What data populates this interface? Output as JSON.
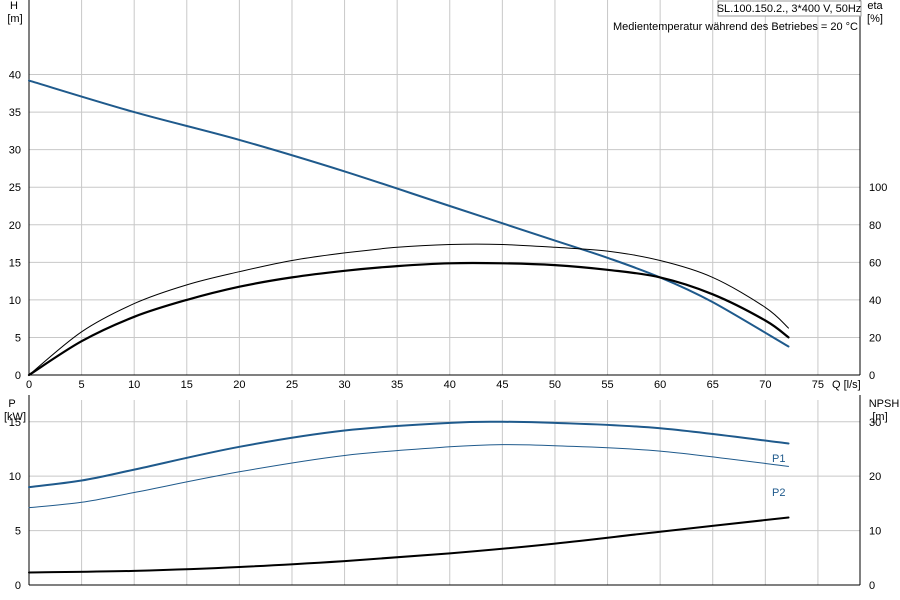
{
  "chart_data": [
    {
      "type": "line",
      "title_box": "SL.100.150.2., 3*400 V, 50Hz",
      "annotation": "Medientemperatur während des Betriebes = 20 °C",
      "xlabel": "Q [l/s]",
      "x_ticks": [
        "0",
        "5",
        "10",
        "15",
        "20",
        "25",
        "30",
        "35",
        "40",
        "45",
        "50",
        "55",
        "60",
        "65",
        "70",
        "75"
      ],
      "xlim": [
        0,
        79
      ],
      "left_axis": {
        "label": "H",
        "unit": "[m]",
        "ylim": [
          0,
          45
        ],
        "ticks": [
          "0",
          "5",
          "10",
          "15",
          "20",
          "25",
          "30",
          "35",
          "40"
        ]
      },
      "right_axis": {
        "label": "eta",
        "unit": "[%]",
        "ylim": [
          0,
          180
        ],
        "ticks": [
          "0",
          "20",
          "40",
          "60",
          "80",
          "100"
        ]
      },
      "grid": true,
      "series": [
        {
          "id": "H",
          "axis": "left",
          "color": "#1f5a8c",
          "width": 2,
          "x": [
            0,
            10,
            20,
            30,
            40,
            50,
            55,
            60,
            65,
            72.2
          ],
          "y": [
            39.2,
            35.0,
            31.3,
            27.1,
            22.5,
            17.9,
            15.6,
            13.0,
            9.7,
            3.8
          ]
        },
        {
          "id": "eta1",
          "axis": "right",
          "color": "#000000",
          "width": 1,
          "x": [
            0,
            5,
            10,
            15,
            20,
            25,
            30,
            35,
            40,
            45,
            50,
            55,
            60,
            65,
            70,
            72.2
          ],
          "y": [
            0,
            23,
            38,
            48,
            55,
            61,
            65,
            68,
            69.5,
            69.5,
            68,
            66,
            61,
            52,
            36,
            25
          ]
        },
        {
          "id": "eta2",
          "axis": "right",
          "color": "#000000",
          "width": 2.2,
          "x": [
            0,
            5,
            10,
            15,
            20,
            25,
            30,
            35,
            40,
            45,
            50,
            55,
            60,
            65,
            70,
            72.2
          ],
          "y": [
            0,
            18,
            31,
            40,
            47,
            52,
            55.5,
            58,
            59.5,
            59.5,
            58.5,
            56,
            52,
            43,
            29,
            20
          ]
        }
      ]
    },
    {
      "type": "line",
      "left_axis": {
        "label": "P",
        "unit": "[kW]",
        "ylim": [
          0,
          17
        ],
        "ticks": [
          "0",
          "5",
          "10",
          "15"
        ]
      },
      "right_axis": {
        "label": "NPSH",
        "unit": "[m]",
        "ylim": [
          0,
          34
        ],
        "ticks": [
          "0",
          "10",
          "20",
          "30"
        ]
      },
      "xlim": [
        0,
        79
      ],
      "grid": true,
      "series": [
        {
          "id": "P1",
          "name": "P1",
          "axis": "left",
          "color": "#1f5a8c",
          "width": 2,
          "x": [
            0,
            5,
            10,
            20,
            30,
            40,
            45,
            50,
            60,
            72.2
          ],
          "y": [
            9.0,
            9.6,
            10.6,
            12.7,
            14.2,
            14.9,
            15.0,
            14.9,
            14.4,
            13.0
          ]
        },
        {
          "id": "P2",
          "name": "P2",
          "axis": "left",
          "color": "#1f5a8c",
          "width": 1,
          "x": [
            0,
            5,
            10,
            20,
            30,
            40,
            45,
            50,
            60,
            72.2
          ],
          "y": [
            7.1,
            7.6,
            8.5,
            10.4,
            11.9,
            12.7,
            12.9,
            12.8,
            12.3,
            10.9
          ]
        },
        {
          "id": "NPSH",
          "axis": "right",
          "color": "#000000",
          "width": 2,
          "x": [
            0,
            10,
            20,
            30,
            40,
            50,
            60,
            72.2
          ],
          "y": [
            2.3,
            2.6,
            3.3,
            4.4,
            5.8,
            7.6,
            9.8,
            12.4
          ]
        }
      ]
    }
  ]
}
